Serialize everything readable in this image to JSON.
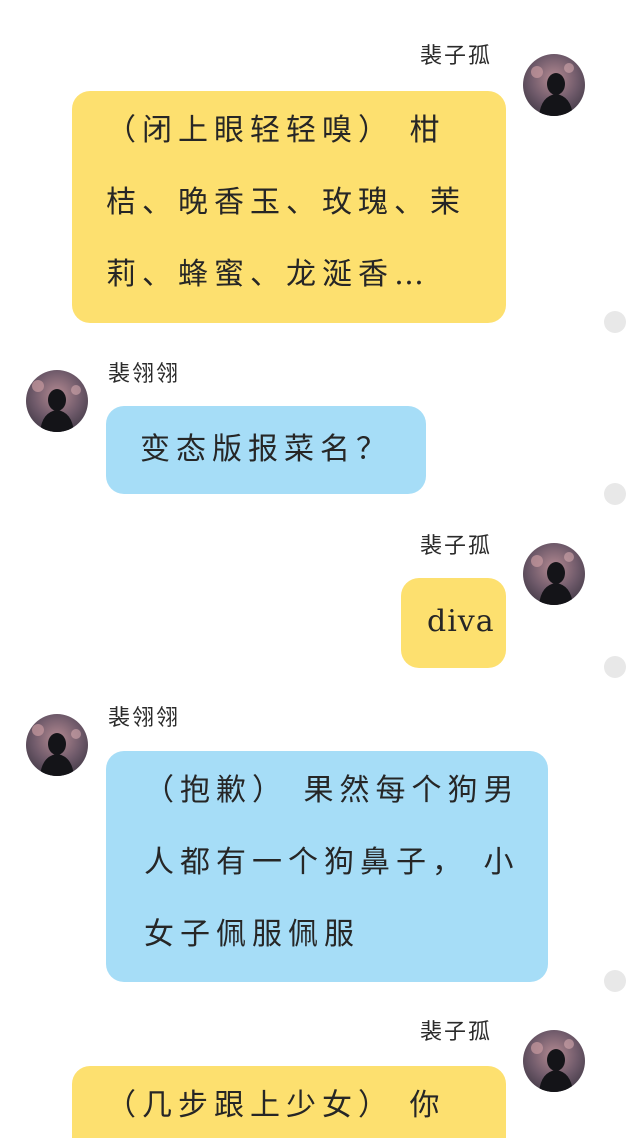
{
  "messages": [
    {
      "sender": "裴子孤",
      "side": "right",
      "color": "#fde06f",
      "lines": [
        "（闭上眼轻轻嗅） 柑",
        "桔、晚香玉、玫瑰、茉",
        "莉、蜂蜜、龙涎香…"
      ]
    },
    {
      "sender": "裴翎翎",
      "side": "left",
      "color": "#a6ddf7",
      "lines": [
        "变态版报菜名？"
      ]
    },
    {
      "sender": "裴子孤",
      "side": "right",
      "color": "#fde06f",
      "lines": [
        "diva"
      ]
    },
    {
      "sender": "裴翎翎",
      "side": "left",
      "color": "#a6ddf7",
      "lines": [
        "（抱歉） 果然每个狗男",
        "人都有一个狗鼻子，  小",
        "女子佩服佩服"
      ]
    },
    {
      "sender": "裴子孤",
      "side": "right",
      "color": "#fde06f",
      "lines": [
        "（几步跟上少女） 你"
      ]
    }
  ],
  "icons": {
    "avatar": "silhouette-avatar-icon",
    "status": "dot-icon"
  }
}
